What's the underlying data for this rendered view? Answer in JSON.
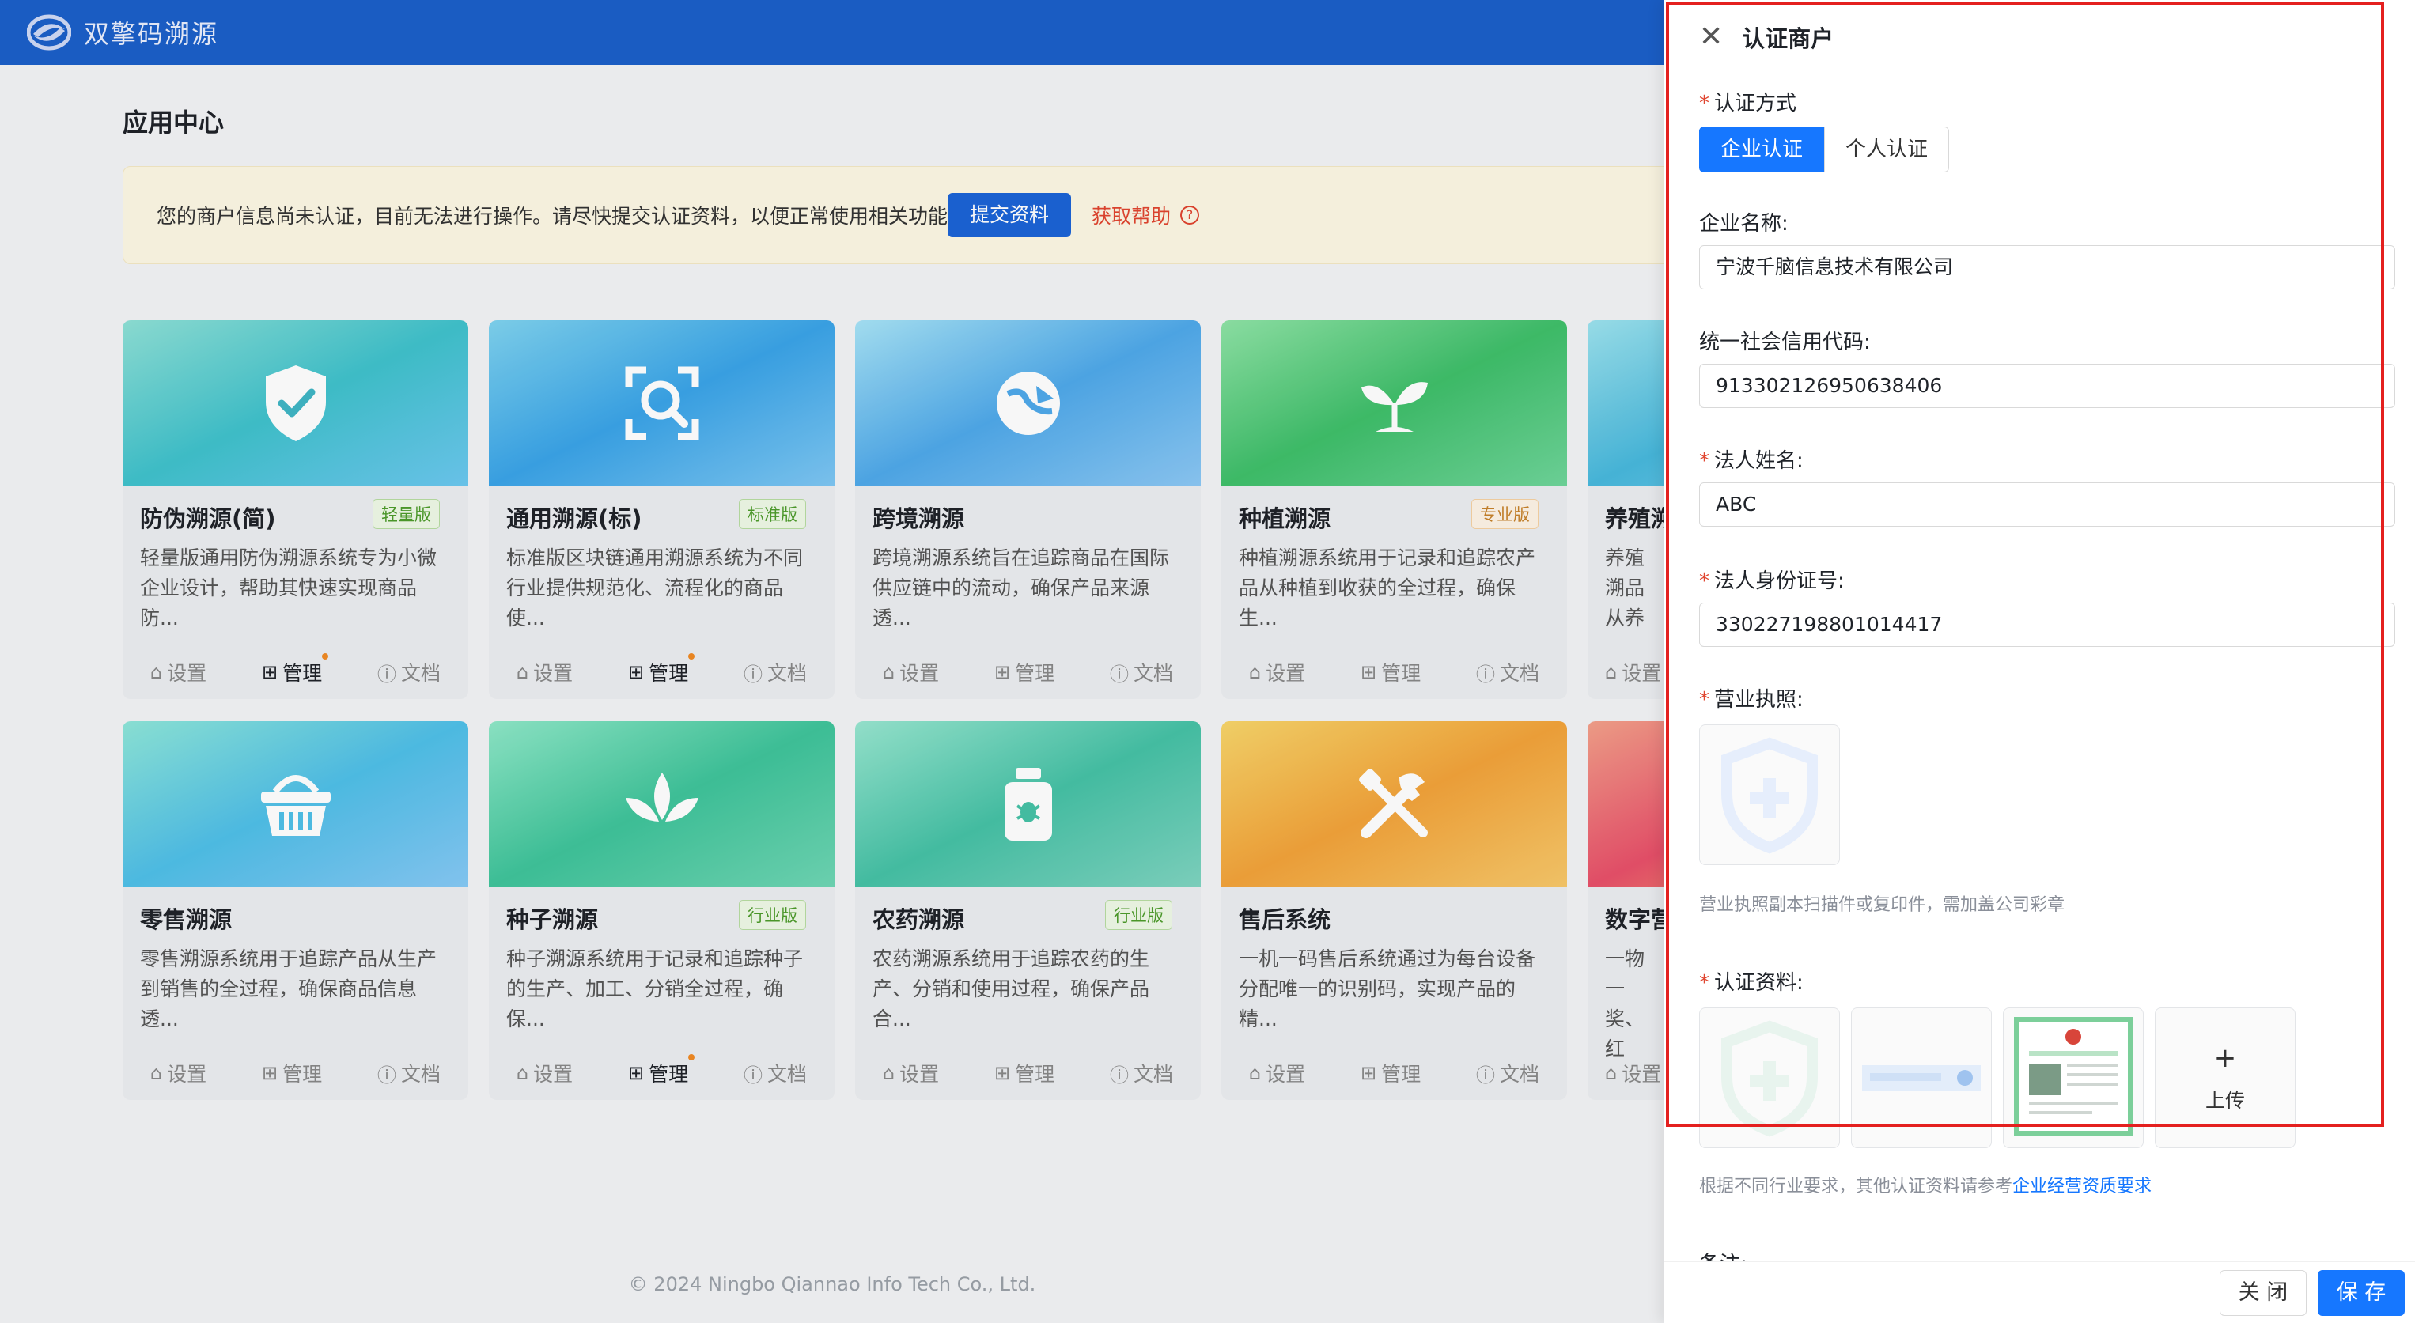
{
  "header": {
    "brand": "双擎码溯源"
  },
  "page": {
    "title": "应用中心"
  },
  "notice": {
    "text": "您的商户信息尚未认证，目前无法进行操作。请尽快提交认证资料，以便正常使用相关功能",
    "submit_label": "提交资料",
    "help_label": "获取帮助"
  },
  "actions": {
    "settings": "设置",
    "manage": "管理",
    "docs": "文档"
  },
  "cards": [
    {
      "title": "防伪溯源(简)",
      "badge": "轻量版",
      "desc": "轻量版通用防伪溯源系统专为小微企业设计，帮助其快速实现商品防...",
      "icon": "shield-check-icon",
      "manage_active": true
    },
    {
      "title": "通用溯源(标)",
      "badge": "标准版",
      "desc": "标准版区块链通用溯源系统为不同行业提供规范化、流程化的商品使...",
      "icon": "scan-icon",
      "manage_active": true
    },
    {
      "title": "跨境溯源",
      "badge": "",
      "desc": "跨境溯源系统旨在追踪商品在国际供应链中的流动，确保产品来源透...",
      "icon": "globe-plane-icon",
      "manage_active": false
    },
    {
      "title": "种植溯源",
      "badge": "专业版",
      "desc": "种植溯源系统用于记录和追踪农产品从种植到收获的全过程，确保生...",
      "icon": "sprout-icon",
      "manage_active": false
    },
    {
      "title": "养殖溯",
      "badge": "",
      "desc": "养殖溯品从养",
      "icon": "animal-icon",
      "manage_active": false
    },
    {
      "title": "零售溯源",
      "badge": "",
      "desc": "零售溯源系统用于追踪产品从生产到销售的全过程，确保商品信息透...",
      "icon": "basket-icon",
      "manage_active": false
    },
    {
      "title": "种子溯源",
      "badge": "行业版",
      "desc": "种子溯源系统用于记录和追踪种子的生产、加工、分销全过程，确保...",
      "icon": "seed-icon",
      "manage_active": true
    },
    {
      "title": "农药溯源",
      "badge": "行业版",
      "desc": "农药溯源系统用于追踪农药的生产、分销和使用过程，确保产品合...",
      "icon": "pesticide-bottle-icon",
      "manage_active": false
    },
    {
      "title": "售后系统",
      "badge": "",
      "desc": "一机一码售后系统通过为每台设备分配唯一的识别码，实现产品的精...",
      "icon": "tools-icon",
      "manage_active": false
    },
    {
      "title": "数字营",
      "badge": "",
      "desc": "一物一奖、红",
      "icon": "gift-icon",
      "manage_active": false
    }
  ],
  "footer": {
    "copyright": "© 2024 Ningbo Qiannao Info Tech Co., Ltd."
  },
  "drawer": {
    "title": "认证商户",
    "auth_method_label": "认证方式",
    "auth_options": [
      "企业认证",
      "个人认证"
    ],
    "company_name_label": "企业名称:",
    "company_name_value": "宁波千脑信息技术有限公司",
    "credit_code_label": "统一社会信用代码:",
    "credit_code_value": "913302126950638406",
    "legal_name_label": "法人姓名:",
    "legal_name_value": "ABC",
    "legal_id_label": "法人身份证号:",
    "legal_id_value": "330227198801014417",
    "license_label": "营业执照:",
    "license_hint": "营业执照副本扫描件或复印件，需加盖公司彩章",
    "materials_label": "认证资料:",
    "upload_label": "上传",
    "materials_hint": "根据不同行业要求，其他认证资料请参考",
    "materials_link": "企业经营资质要求",
    "remark_label": "备注:",
    "close_label": "关 闭",
    "save_label": "保 存"
  },
  "colors": {
    "header": "#1b5fc9",
    "accent": "#1677ff",
    "danger": "#e0452f",
    "highlight_frame": "#e4201f"
  }
}
